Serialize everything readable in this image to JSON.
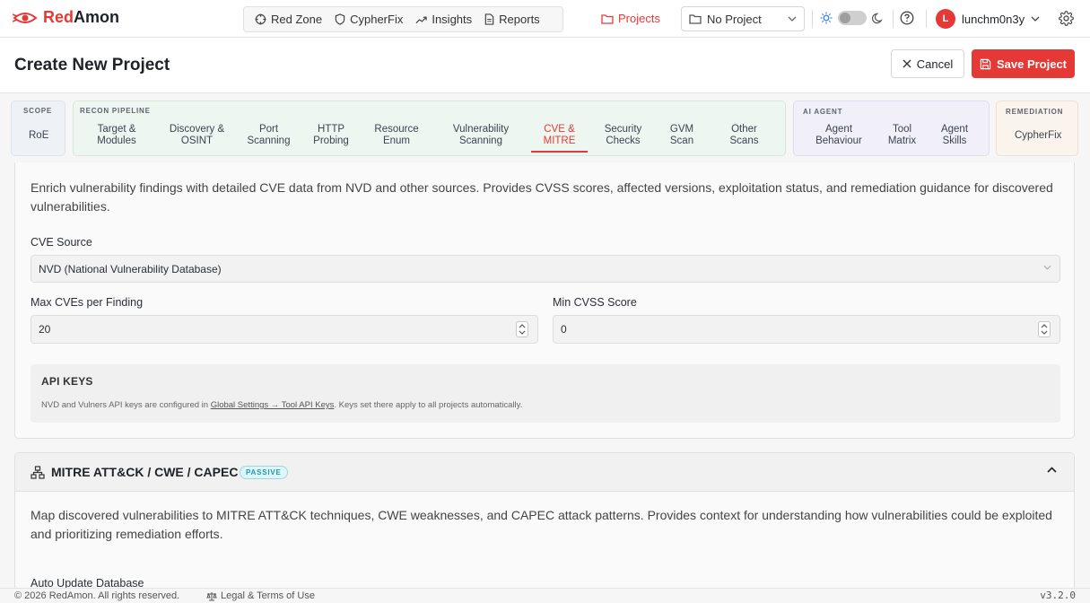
{
  "app": {
    "name_part1": "Red",
    "name_part2": "Amon",
    "brand_color": "#e53935"
  },
  "topnav": {
    "items": [
      {
        "label": "Red Zone",
        "icon": "crosshair-icon"
      },
      {
        "label": "CypherFix",
        "icon": "shield-icon"
      },
      {
        "label": "Insights",
        "icon": "trending-up-icon"
      },
      {
        "label": "Reports",
        "icon": "file-text-icon"
      }
    ],
    "projects_label": "Projects",
    "project_select": "No Project",
    "user": {
      "initial": "L",
      "name": "lunchm0n3y"
    }
  },
  "header": {
    "title": "Create New Project",
    "cancel_label": "Cancel",
    "save_label": "Save Project"
  },
  "tabs": {
    "scope": {
      "label": "SCOPE",
      "items": [
        "RoE"
      ]
    },
    "recon": {
      "label": "RECON PIPELINE",
      "items": [
        [
          "Target &",
          "Modules"
        ],
        [
          "Discovery &",
          "OSINT"
        ],
        [
          "Port",
          "Scanning"
        ],
        [
          "HTTP",
          "Probing"
        ],
        [
          "Resource",
          "Enum"
        ],
        [
          "Vulnerability",
          "Scanning"
        ],
        [
          "CVE &",
          "MITRE"
        ],
        [
          "Security",
          "Checks"
        ],
        [
          "GVM",
          "Scan"
        ],
        [
          "Other",
          "Scans"
        ]
      ],
      "active_index": 6
    },
    "ai": {
      "label": "AI AGENT",
      "items": [
        [
          "Agent",
          "Behaviour"
        ],
        [
          "Tool",
          "Matrix"
        ],
        [
          "Agent",
          "Skills"
        ]
      ]
    },
    "remediation": {
      "label": "REMEDIATION",
      "items": [
        "CypherFix"
      ]
    }
  },
  "cve_section": {
    "description": "Enrich vulnerability findings with detailed CVE data from NVD and other sources. Provides CVSS scores, affected versions, exploitation status, and remediation guidance for discovered vulnerabilities.",
    "source_label": "CVE Source",
    "source_value": "NVD (National Vulnerability Database)",
    "max_label": "Max CVEs per Finding",
    "max_value": "20",
    "min_label": "Min CVSS Score",
    "min_value": "0",
    "api_keys": {
      "title": "API KEYS",
      "text_before": "NVD and Vulners API keys are configured in ",
      "link": "Global Settings → Tool API Keys",
      "text_after": ". Keys set there apply to all projects automatically."
    }
  },
  "mitre_section": {
    "title": "MITRE ATT&CK / CWE / CAPEC",
    "badge": "PASSIVE",
    "description": "Map discovered vulnerabilities to MITRE ATT&CK techniques, CWE weaknesses, and CAPEC attack patterns. Provides context for understanding how vulnerabilities could be exploited and prioritizing remediation efforts.",
    "auto_update_label": "Auto Update Database"
  },
  "footer": {
    "copyright": "© 2026 RedAmon. All rights reserved.",
    "legal": "Legal & Terms of Use",
    "version": "v3.2.0"
  }
}
